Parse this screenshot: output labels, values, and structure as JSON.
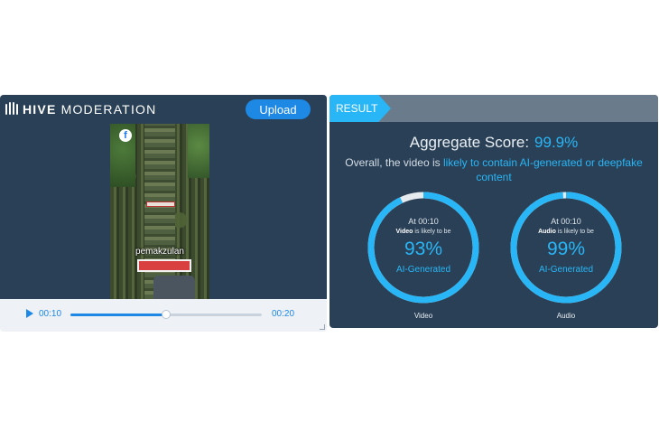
{
  "header": {
    "brand_bold": "HIVE",
    "brand_light": "MODERATION",
    "upload_label": "Upload"
  },
  "video": {
    "caption": "pemakzulan",
    "current_time": "00:10",
    "end_time": "00:20",
    "progress_fraction": 0.5
  },
  "result": {
    "tab_label": "RESULT",
    "aggregate_label": "Aggregate Score:",
    "aggregate_value": "99.9%",
    "overall_prefix": "Overall, the video is ",
    "overall_highlight": "likely to contain AI-generated or deepfake content",
    "gauges": [
      {
        "at": "At 00:10",
        "media": "Video",
        "likely_suffix": " is likely to be",
        "percent": "93%",
        "percent_value": 93,
        "label": "AI-Generated",
        "name": "Video"
      },
      {
        "at": "At 00:10",
        "media": "Audio",
        "likely_suffix": " is likely to be",
        "percent": "99%",
        "percent_value": 99,
        "label": "AI-Generated",
        "name": "Audio"
      }
    ]
  },
  "colors": {
    "accent": "#29b6f6",
    "panel": "#2a4056",
    "ring_track": "#e6ebf0",
    "upload": "#1e88e5"
  },
  "icons": {
    "logo": "hive-logo-icon",
    "play": "play-icon",
    "social": "facebook-icon"
  }
}
